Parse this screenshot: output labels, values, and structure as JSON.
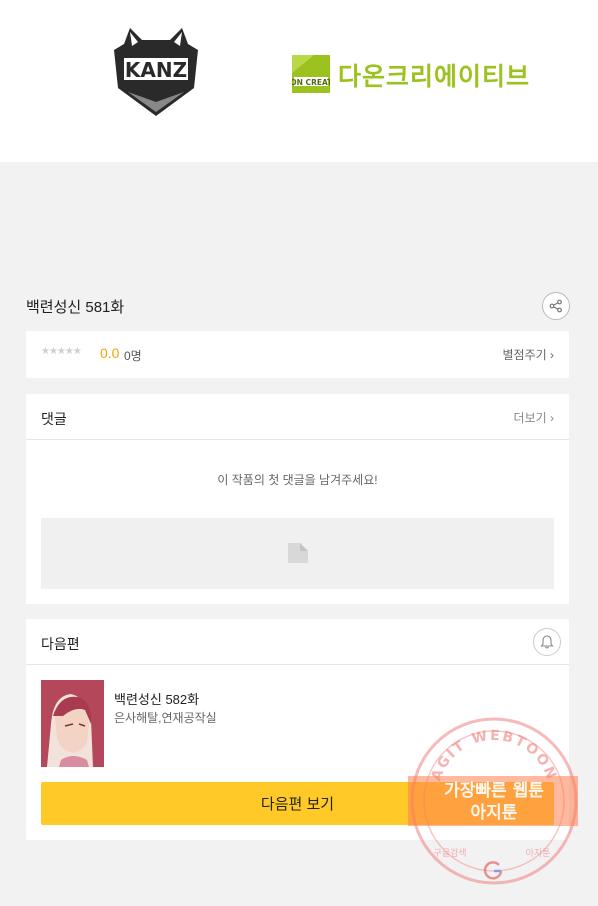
{
  "banner": {
    "publisher_logo_text": "KANZ",
    "studio_logo_mark": "DA'ON CREATIVE",
    "studio_name": "다온크리에이티브",
    "studio_color": "#9cc21f"
  },
  "episode": {
    "title": "백련성신 581화"
  },
  "rating": {
    "stars": "★★★★★",
    "score": "0.0",
    "count": "0명",
    "rate_label": "별점주기 ›"
  },
  "comments": {
    "header": "댓글",
    "more_label": "더보기 ›",
    "empty_message": "이 작품의 첫 댓글을 남겨주세요!"
  },
  "next": {
    "header": "다음편",
    "title": "백련성신 582화",
    "author": "은사해탈,연재공작실",
    "button_label": "다음편 보기",
    "button_color": "#ffc928"
  },
  "watermark": {
    "arc_text": "AGIT WEBTOON",
    "line1": "가장빠른 웹툰",
    "line2": "아지툰",
    "bottom_left": "구글검색",
    "bottom_right": "아지툰"
  },
  "icons": {
    "share": "share-icon",
    "bell": "bell-icon",
    "ad_placeholder": "image-placeholder-icon"
  }
}
